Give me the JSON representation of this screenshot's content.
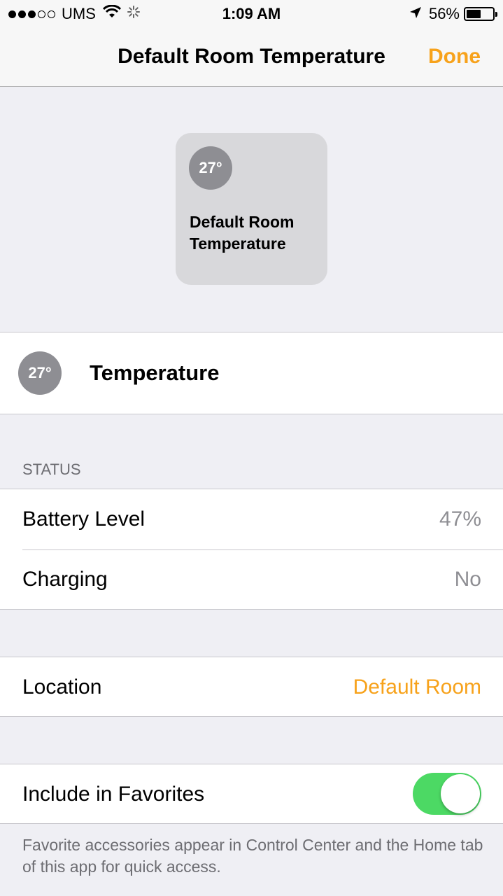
{
  "status_bar": {
    "signal_bars": 3,
    "signal_max": 5,
    "carrier": "UMS",
    "time": "1:09 AM",
    "battery_percent": "56%",
    "battery_level": 0.56,
    "icons": [
      "wifi-icon",
      "activity-spinner-icon",
      "location-arrow-icon",
      "battery-icon"
    ]
  },
  "nav": {
    "title": "Default Room Temperature",
    "done_label": "Done"
  },
  "tile": {
    "badge": "27°",
    "name": "Default Room Temperature"
  },
  "service": {
    "badge": "27°",
    "label": "Temperature"
  },
  "status_section": {
    "header": "STATUS",
    "rows": [
      {
        "label": "Battery Level",
        "value": "47%"
      },
      {
        "label": "Charging",
        "value": "No"
      }
    ]
  },
  "location": {
    "label": "Location",
    "value": "Default Room"
  },
  "favorites": {
    "label": "Include in Favorites",
    "enabled": true,
    "note": "Favorite accessories appear in Control Center and the Home tab of this app for quick access."
  },
  "colors": {
    "accent": "#f7a21b",
    "toggle_on": "#4cd964",
    "secondary_text": "#8e8e93",
    "background": "#efeff4"
  }
}
